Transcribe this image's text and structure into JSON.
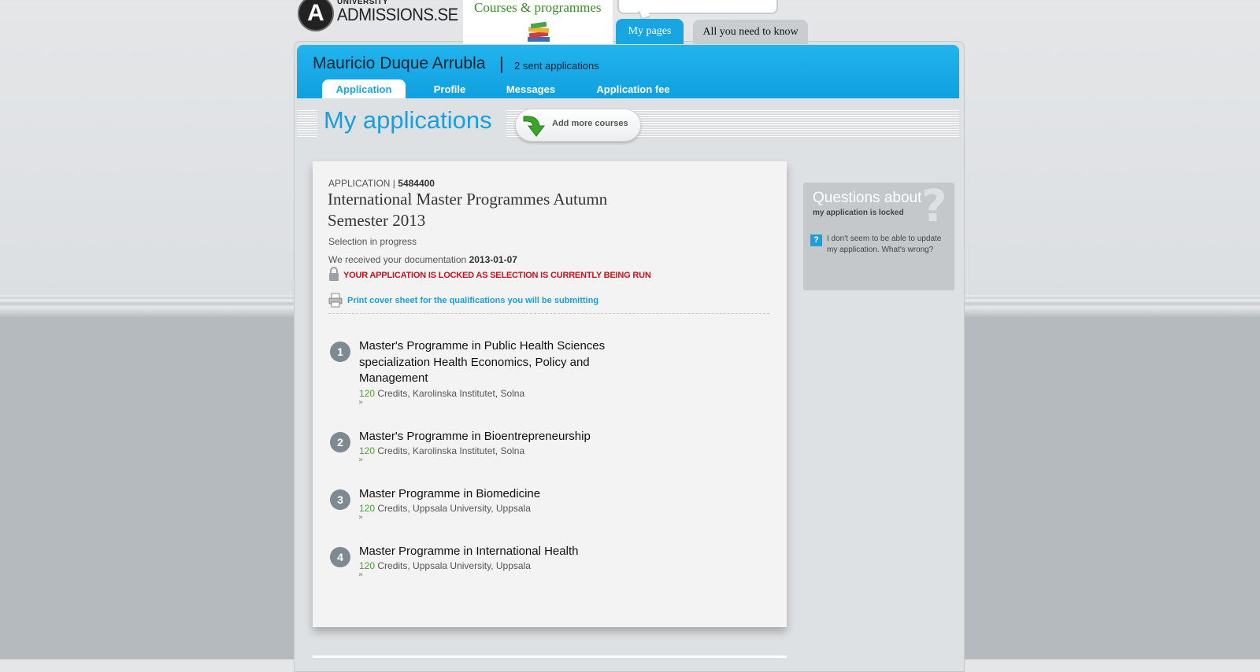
{
  "header": {
    "logo_small": "UNIVERSITY",
    "logo_main": "ADMISSIONS.SE",
    "courses_tab": "Courses & programmes",
    "my_pages_tab": "My pages",
    "all_you_need_tab": "All you need to know"
  },
  "user": {
    "name": "Mauricio Duque Arrubla",
    "separator": "|",
    "sent_applications": "2 sent applications"
  },
  "subtabs": [
    "Application",
    "Profile",
    "Messages",
    "Application fee"
  ],
  "page": {
    "title": "My applications",
    "add_courses": "Add more courses"
  },
  "application": {
    "label": "APPLICATION",
    "number": "5484400",
    "title": "International Master Programmes Autumn Semester 2013",
    "status": "Selection in progress",
    "received_text": "We received your documentation",
    "received_date": "2013-01-07",
    "locked_notice": "YOUR APPLICATION IS LOCKED AS SELECTION IS CURRENTLY BEING RUN",
    "print_link": "Print cover sheet for the qualifications you will be submitting"
  },
  "courses": [
    {
      "rank": "1",
      "title": "Master's Programme in Public Health Sciences specialization Health Economics, Policy and Management",
      "credits": "120",
      "details": "Credits, Karolinska Institutet, Solna"
    },
    {
      "rank": "2",
      "title": "Master's Programme in Bioentrepreneurship",
      "credits": "120",
      "details": "Credits, Karolinska Institutet, Solna"
    },
    {
      "rank": "3",
      "title": "Master Programme in Biomedicine",
      "credits": "120",
      "details": "Credits, Uppsala University, Uppsala"
    },
    {
      "rank": "4",
      "title": "Master Programme in International Health",
      "credits": "120",
      "details": "Credits, Uppsala University, Uppsala"
    }
  ],
  "sidebar": {
    "title": "Questions about",
    "subtitle": "my application is locked",
    "question": "I don't seem to be able to update my application. What's wrong?"
  }
}
